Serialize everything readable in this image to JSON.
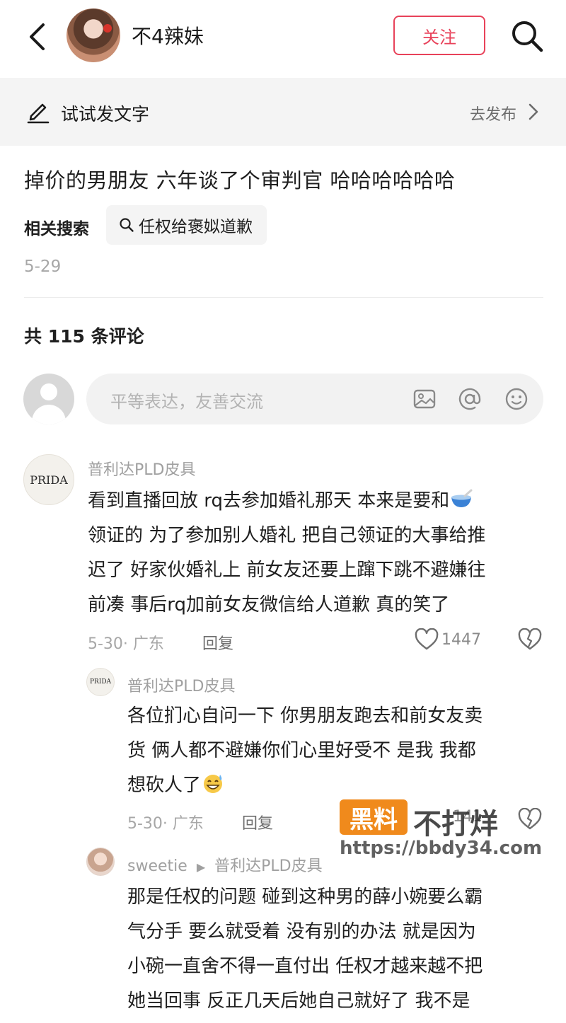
{
  "header": {
    "username": "不4辣妹",
    "follow_label": "关注",
    "icons": {
      "back": "chevron-left-icon",
      "search": "search-icon"
    }
  },
  "try_post": {
    "label": "试试发文字",
    "go_label": "去发布",
    "icons": {
      "pen": "pen-icon",
      "arrow": "chevron-right-icon"
    }
  },
  "post": {
    "text": "掉价的男朋友  六年谈了个审判官  哈哈哈哈哈哈",
    "related_label": "相关搜索",
    "related_query": "任权给褒姒道歉",
    "date": "5-29"
  },
  "comments_header": {
    "count_text": "共 115 条评论"
  },
  "comment_input": {
    "placeholder": "平等表达，友善交流",
    "icons": [
      "image-icon",
      "at-icon",
      "emoji-icon"
    ]
  },
  "comments": [
    {
      "avatar_text": "PRIDA",
      "author": "普利达PLD皮具",
      "lines": [
        "看到直播回放 rq去参加婚礼那天 本来是要和",
        "领证的 为了参加别人婚礼 把自己领证的大事给推",
        "迟了 好家伙婚礼上 前女友还要上蹿下跳不避嫌往",
        "前凑 事后rq加前女友微信给人道歉 真的笑了"
      ],
      "meta": "5-30· 广东",
      "reply_label": "回复",
      "likes": "1447"
    },
    {
      "avatar_text": "PRIDA",
      "author": "普利达PLD皮具",
      "lines": [
        "各位扪心自问一下 你男朋友跑去和前女友卖",
        "货 俩人都不避嫌你们心里好受不 是我 我都",
        "想砍人了"
      ],
      "meta": "5-30· 广东",
      "reply_label": "回复",
      "likes": "141"
    },
    {
      "author": "sweetie",
      "reply_to": "普利达PLD皮具",
      "lines": [
        "那是任权的问题  碰到这种男的薛小婉要么霸",
        "气分手  要么就受着  没有别的办法  就是因为",
        "小碗一直舍不得一直付出  任权才越来越不把",
        "她当回事  反正几天后她自己就好了  我不是"
      ]
    }
  ],
  "watermark": {
    "box_text": "黑料",
    "text": "不打烊",
    "url": "https://bbdy34.com"
  },
  "colors": {
    "accent": "#e8425a",
    "watermark_orange": "#f08a1c"
  }
}
